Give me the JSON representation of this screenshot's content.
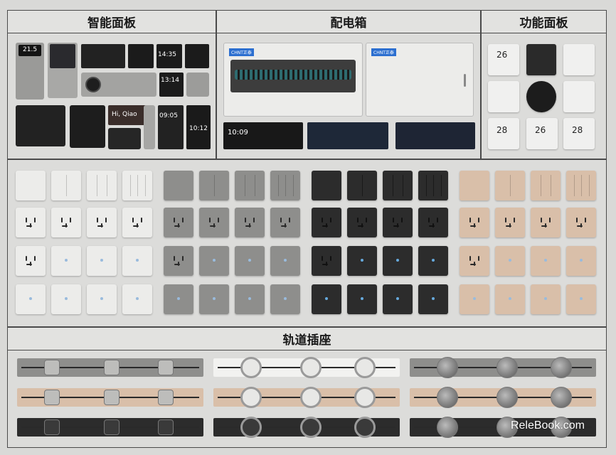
{
  "sections": {
    "smart_panel": "智能面板",
    "distribution_box": "配电箱",
    "function_panel": "功能面板",
    "track_socket": "轨道插座"
  },
  "screens": {
    "clock_a": "21.5",
    "clock_b": "14:35",
    "clock_c": "13:14",
    "clock_d": "10:09",
    "clock_e": "09:05",
    "clock_f": "10:12",
    "greeting": "Hi, Qiao",
    "thermo_a": "26",
    "thermo_b": "28",
    "thermo_c": "26",
    "thermo_d": "28",
    "box_brand_a": "CHNT正泰",
    "box_brand_b": "CHNT正泰"
  },
  "watermark": "ReleBook.com",
  "colors": {
    "white": "#ececea",
    "grey": "#8e8e8c",
    "black": "#2c2c2c",
    "beige": "#d9bfa9",
    "frame": "#4a4a4a"
  }
}
